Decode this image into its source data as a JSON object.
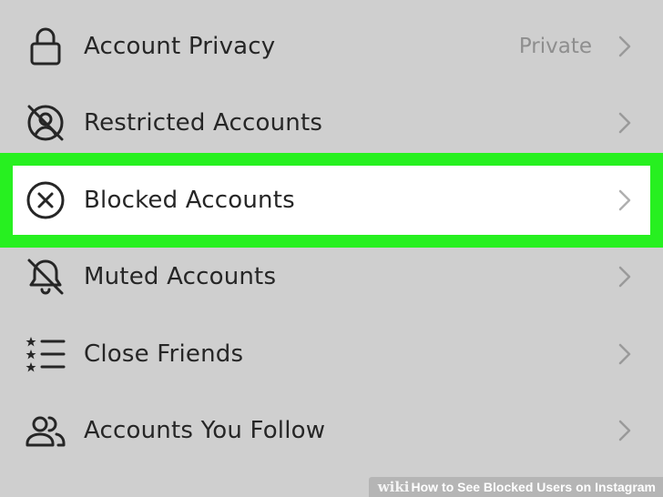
{
  "settings": {
    "items": [
      {
        "label": "Account Privacy",
        "value": "Private",
        "icon": "lock-icon"
      },
      {
        "label": "Restricted Accounts",
        "value": "",
        "icon": "restricted-icon"
      },
      {
        "label": "Blocked Accounts",
        "value": "",
        "icon": "blocked-x-icon"
      },
      {
        "label": "Muted Accounts",
        "value": "",
        "icon": "muted-bell-icon"
      },
      {
        "label": "Close Friends",
        "value": "",
        "icon": "star-list-icon"
      },
      {
        "label": "Accounts You Follow",
        "value": "",
        "icon": "people-icon"
      }
    ]
  },
  "highlight": {
    "color": "#27f020",
    "item": "Blocked Accounts"
  },
  "watermark": {
    "brand": "wiki",
    "how": "How",
    "title": "to See Blocked Users on Instagram"
  }
}
